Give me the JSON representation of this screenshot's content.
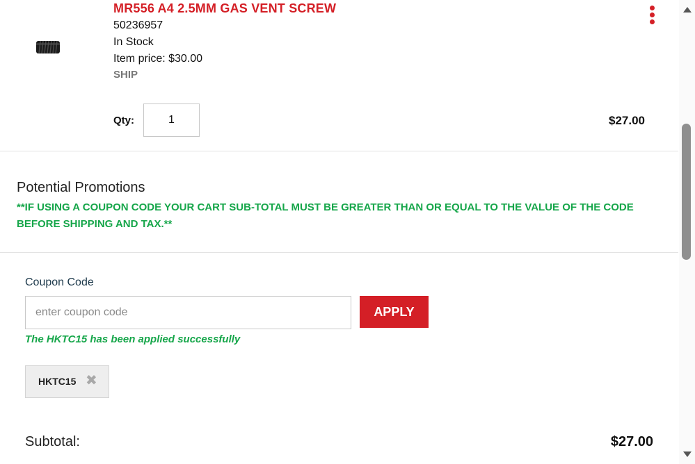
{
  "cart_item": {
    "title": "MR556 A4 2.5MM GAS VENT SCREW",
    "sku": "50236957",
    "stock": "In Stock",
    "item_price": "Item price: $30.00",
    "fulfillment": "SHIP",
    "qty_label": "Qty:",
    "qty_value": "1",
    "line_total": "$27.00",
    "menu_icon": "kebab-menu-icon"
  },
  "promotions": {
    "title": "Potential Promotions",
    "note": "**IF USING A COUPON CODE YOUR CART SUB-TOTAL MUST BE GREATER THAN OR EQUAL TO THE VALUE OF THE CODE BEFORE SHIPPING AND TAX.**"
  },
  "coupon": {
    "label": "Coupon Code",
    "placeholder": "enter coupon code",
    "value": "",
    "apply_label": "APPLY",
    "success_message": "The HKTC15 has been applied successfully",
    "applied_code": "HKTC15",
    "remove_glyph": "✖"
  },
  "summary": {
    "subtotal_label": "Subtotal:",
    "subtotal_value": "$27.00"
  },
  "colors": {
    "brand_red": "#d41f26",
    "success_green": "#16a64a"
  }
}
